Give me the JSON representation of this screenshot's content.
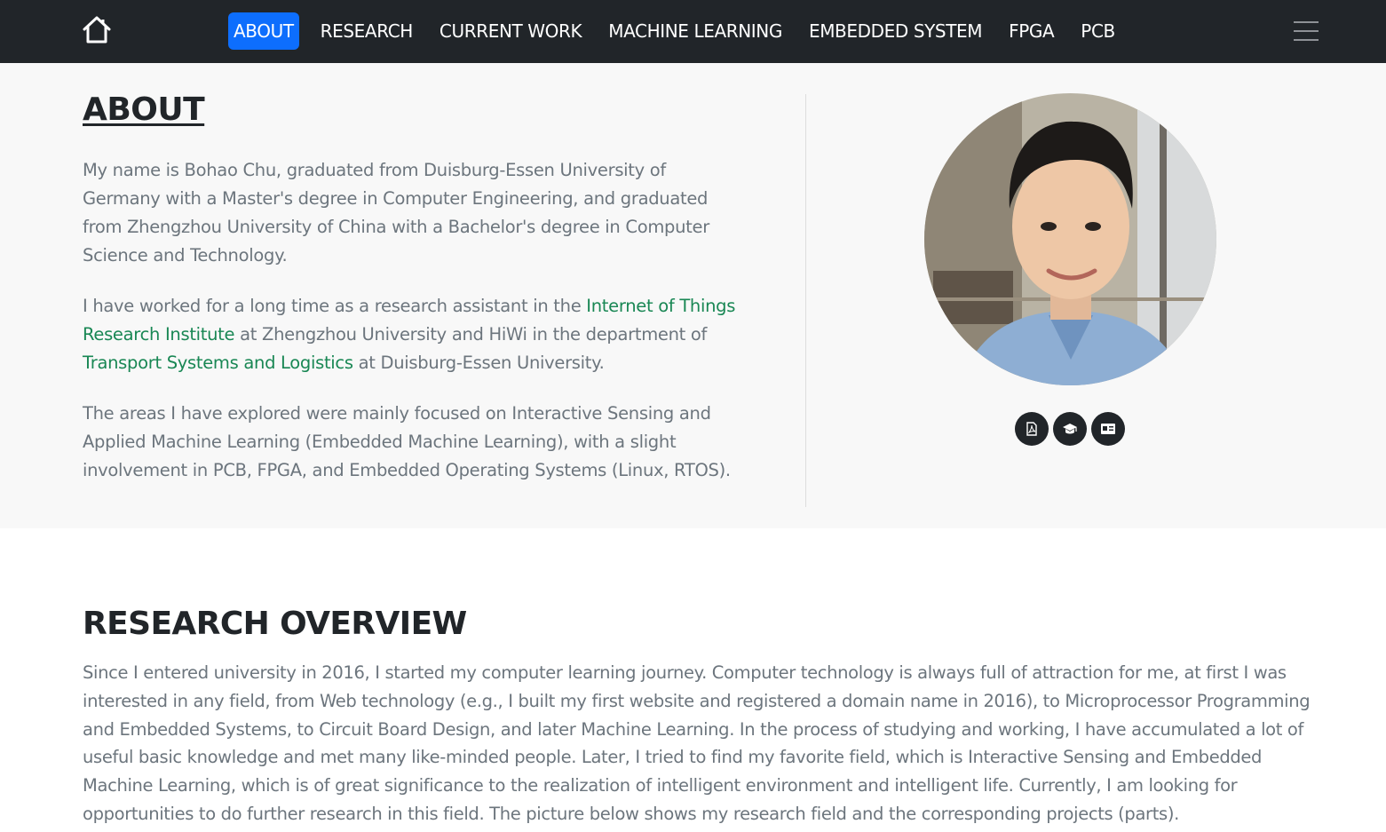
{
  "nav": {
    "home_icon": "home-icon",
    "items": [
      {
        "label": "ABOUT",
        "active": true
      },
      {
        "label": "RESEARCH"
      },
      {
        "label": "CURRENT WORK"
      },
      {
        "label": "MACHINE LEARNING"
      },
      {
        "label": "EMBEDDED SYSTEM"
      },
      {
        "label": "FPGA"
      },
      {
        "label": "PCB"
      }
    ],
    "menu_icon": "hamburger-menu-icon"
  },
  "about": {
    "title": "ABOUT",
    "p1": "My name is Bohao Chu, graduated from Duisburg-Essen University of Germany with a Master's degree in Computer Engineering, and graduated from Zhengzhou University of China with a Bachelor's degree in Computer Science and Technology.",
    "p2_a": "I have worked for a long time as a research assistant in the ",
    "p2_link1": "Internet of Things Research Institute",
    "p2_b": " at Zhengzhou University and HiWi in the department of ",
    "p2_link2": "Transport Systems and Logistics",
    "p2_c": " at Duisburg-Essen University.",
    "p3": "The areas I have explored were mainly focused on Interactive Sensing and Applied Machine Learning (Embedded Machine Learning), with a slight involvement in PCB, FPGA, and Embedded Operating Systems (Linux, RTOS).",
    "social_icons": [
      "pdf-icon",
      "graduation-cap-icon",
      "id-card-icon"
    ]
  },
  "research": {
    "title": "RESEARCH OVERVIEW",
    "text": "Since I entered university in 2016, I started my computer learning journey. Computer technology is always full of attraction for me, at first I was interested in any field, from Web technology (e.g., I built my first website and registered a domain name in 2016), to Microprocessor Programming and Embedded Systems, to Circuit Board Design, and later Machine Learning. In the process of studying and working, I have accumulated a lot of useful basic knowledge and met many like-minded people. Later, I tried to find my favorite field, which is Interactive Sensing and Embedded Machine Learning, which is of great significance to the realization of intelligent environment and intelligent life. Currently, I am looking for opportunities to do further research in this field. The picture below shows my research field and the corresponding projects (parts)."
  },
  "colors": {
    "navbar": "#212529",
    "active": "#0d6efd",
    "link": "#198754",
    "muted_text": "#6c757d"
  }
}
